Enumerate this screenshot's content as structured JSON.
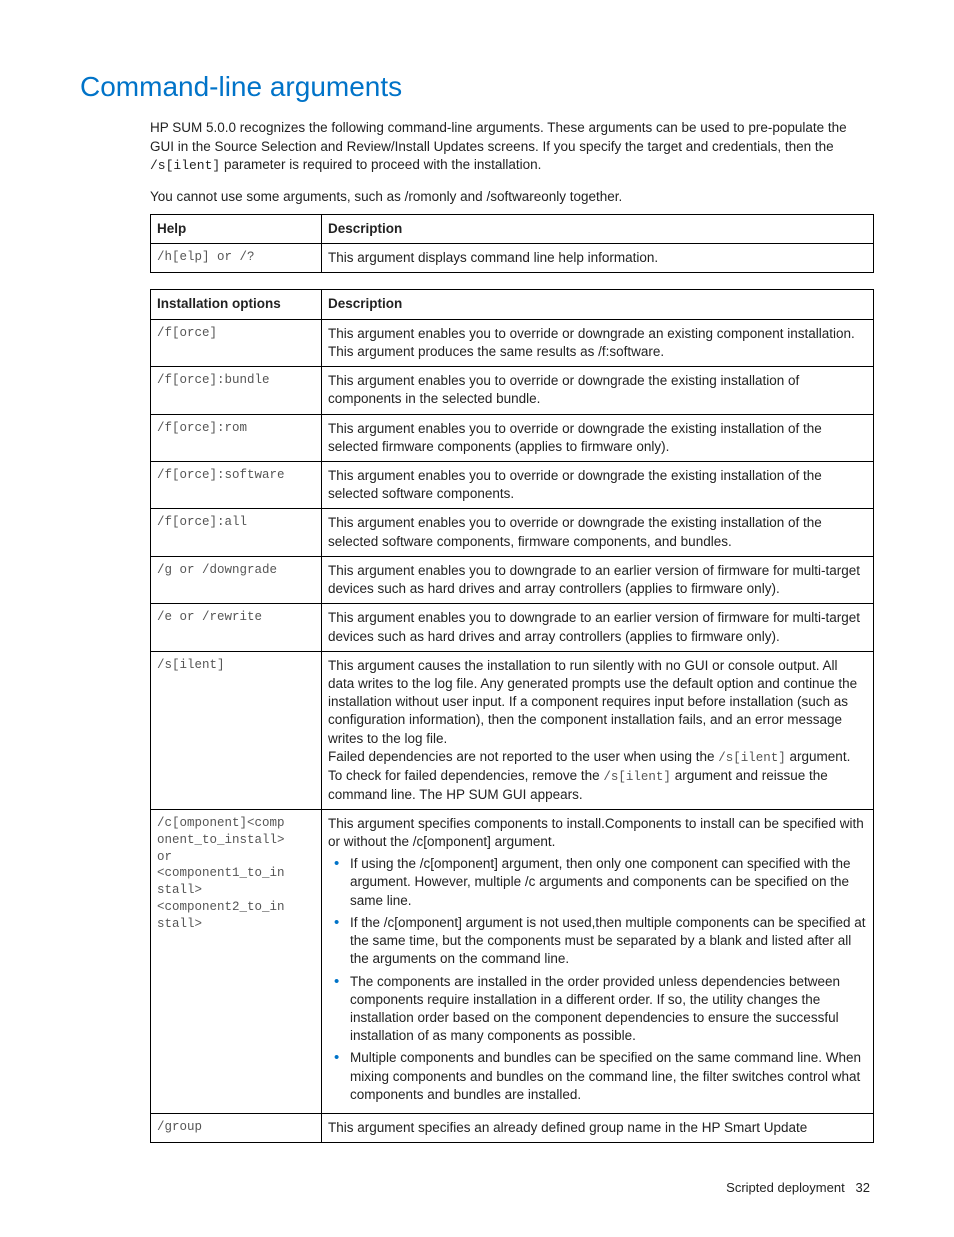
{
  "title": "Command-line arguments",
  "intro_p1_a": "HP SUM 5.0.0 recognizes the following command-line arguments. These arguments can be used to pre-populate the GUI in the Source Selection and Review/Install Updates screens. If you specify the target and credentials, then the ",
  "intro_p1_code": "/s[ilent]",
  "intro_p1_b": " parameter is required to proceed with the installation.",
  "intro_p2": "You cannot use some arguments, such as /romonly and /softwareonly together.",
  "table1": {
    "h1": "Help",
    "h2": "Description",
    "r1c1": "/h[elp] or /?",
    "r1c2": "This argument displays command line help information."
  },
  "table2": {
    "h1": "Installation options",
    "h2": "Description",
    "rows": {
      "force": {
        "c": "/f[orce]",
        "d": "This argument enables you to override or downgrade an existing component installation. This argument produces the same results as /f:software."
      },
      "bundle": {
        "c": "/f[orce]:bundle",
        "d": "This argument enables you to override or downgrade the existing installation of components in the selected bundle."
      },
      "rom": {
        "c": "/f[orce]:rom",
        "d": "This argument enables you to override or downgrade the existing installation of the selected firmware components (applies to firmware only)."
      },
      "software": {
        "c": "/f[orce]:software",
        "d": "This argument enables you to override or downgrade the existing installation of the selected software components."
      },
      "all": {
        "c": "/f[orce]:all",
        "d": "This argument enables you to override or downgrade the existing installation of the selected software components, firmware components, and bundles."
      },
      "downgrade": {
        "c": "/g or /downgrade",
        "d": "This argument enables you to downgrade to an earlier version of firmware for multi-target devices such as hard drives and array controllers (applies to firmware only)."
      },
      "rewrite": {
        "c": "/e or /rewrite",
        "d": "This argument enables you to downgrade to an earlier version of firmware for multi-target devices such as hard drives and array controllers (applies to firmware only)."
      },
      "silent": {
        "c": "/s[ilent]",
        "d1": "This argument causes the installation to run silently with no GUI or console output. All data writes to the log file. Any generated prompts use the default option and continue the installation without user input. If a component requires input before installation (such as configuration information), then the component installation fails, and an error message writes to the log file.",
        "d2a": "Failed dependencies are not reported to the user when using the ",
        "d2code1": "/s[ilent]",
        "d2b": " argument. To check for failed dependencies, remove the ",
        "d2code2": "/s[ilent]",
        "d2c": " argument and reissue the command line. The HP SUM GUI appears."
      },
      "component": {
        "c_line1": "/c[omponent]<comp",
        "c_line2": "onent_to_install>",
        "c_line3": "or",
        "c_line4": "<component1_to_in",
        "c_line5": "stall>",
        "c_line6": "<component2_to_in",
        "c_line7": "stall>",
        "d_intro": "This argument specifies components to install.Components to install can be specified with or without the /c[omponent] argument.",
        "b1": "If using the /c[omponent] argument, then only one component can specified with the argument. However, multiple /c arguments and components can be specified on the same line.",
        "b2": "If the /c[omponent] argument is not used,then multiple components can be specified at the same time, but the components must be separated by a blank and listed after all the arguments on the command line.",
        "b3": "The components are installed in the order provided unless dependencies between components require installation in a different order. If so, the utility changes the installation order based on the component dependencies to ensure the successful installation of as many components as possible.",
        "b4": "Multiple components and bundles can be specified on the same command line. When mixing components and bundles on the command line, the filter switches control what components and bundles are installed."
      },
      "group": {
        "c": "/group",
        "d": "This argument specifies an already defined group name in the HP Smart Update"
      }
    }
  },
  "footer_text": "Scripted deployment",
  "footer_page": "32"
}
